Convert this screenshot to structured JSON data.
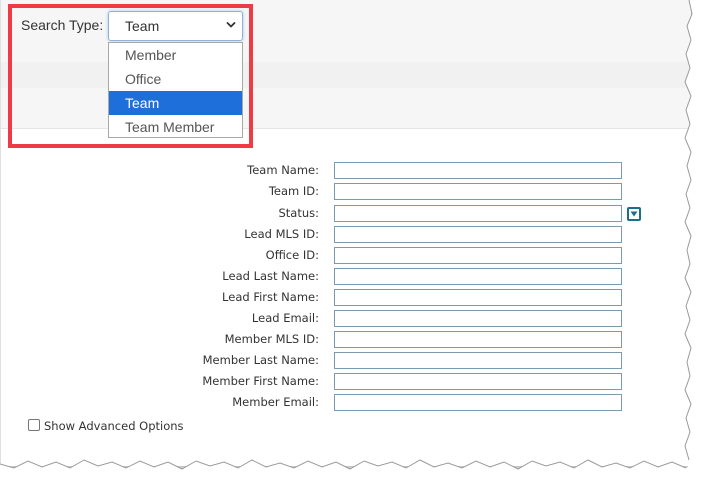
{
  "search_type": {
    "label": "Search Type:",
    "selected_value": "Team",
    "options": [
      {
        "label": "Member",
        "selected": false
      },
      {
        "label": "Office",
        "selected": false
      },
      {
        "label": "Team",
        "selected": true
      },
      {
        "label": "Team Member",
        "selected": false
      }
    ]
  },
  "form": {
    "fields": [
      {
        "label": "Team Name:",
        "value": ""
      },
      {
        "label": "Team ID:",
        "value": ""
      },
      {
        "label": "Status:",
        "value": ""
      },
      {
        "label": "Lead MLS ID:",
        "value": ""
      },
      {
        "label": "Office ID:",
        "value": ""
      },
      {
        "label": "Lead Last Name:",
        "value": ""
      },
      {
        "label": "Lead First Name:",
        "value": ""
      },
      {
        "label": "Lead Email:",
        "value": ""
      },
      {
        "label": "Member MLS ID:",
        "value": ""
      },
      {
        "label": "Member Last Name:",
        "value": ""
      },
      {
        "label": "Member First Name:",
        "value": ""
      },
      {
        "label": "Member Email:",
        "value": ""
      }
    ],
    "status_dropdown_icon": "dropdown-arrow-icon"
  },
  "advanced": {
    "label": "Show Advanced Options",
    "checked": false
  },
  "colors": {
    "highlight_border": "#ee3b45",
    "selected_option_bg": "#1e6fd9",
    "input_border": "#7b9ab0",
    "status_button": "#1b6f8a"
  },
  "icons": {
    "select_chevron": "chevron-down-icon",
    "status_dropdown": "dropdown-arrow-icon"
  }
}
